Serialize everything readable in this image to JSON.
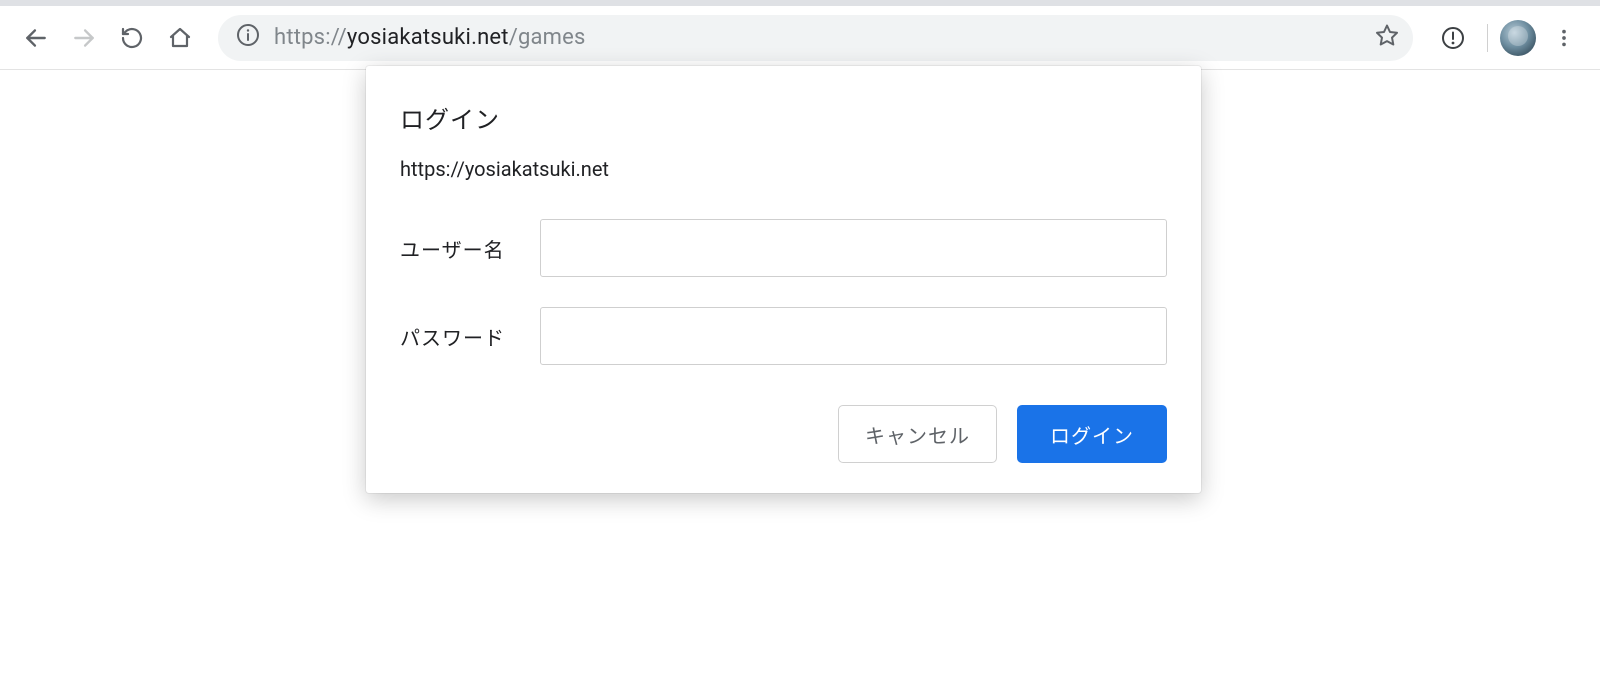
{
  "toolbar": {
    "url_protocol": "https://",
    "url_host": "yosiakatsuki.net",
    "url_path": "/games",
    "icons": {
      "back": "back-icon",
      "forward": "forward-icon",
      "reload": "reload-icon",
      "home": "home-icon",
      "site_info": "info-icon",
      "bookmark": "star-icon",
      "saved_passwords": "key-alert-icon",
      "profile": "avatar",
      "menu": "kebab-menu-icon"
    }
  },
  "dialog": {
    "title": "ログイン",
    "origin": "https://yosiakatsuki.net",
    "username_label": "ユーザー名",
    "password_label": "パスワード",
    "username_value": "",
    "password_value": "",
    "cancel_label": "キャンセル",
    "submit_label": "ログイン"
  },
  "colors": {
    "primary": "#1a73e8",
    "toolbar_bg": "#ffffff",
    "omnibox_bg": "#f1f3f4",
    "text_muted": "#5f6368"
  }
}
